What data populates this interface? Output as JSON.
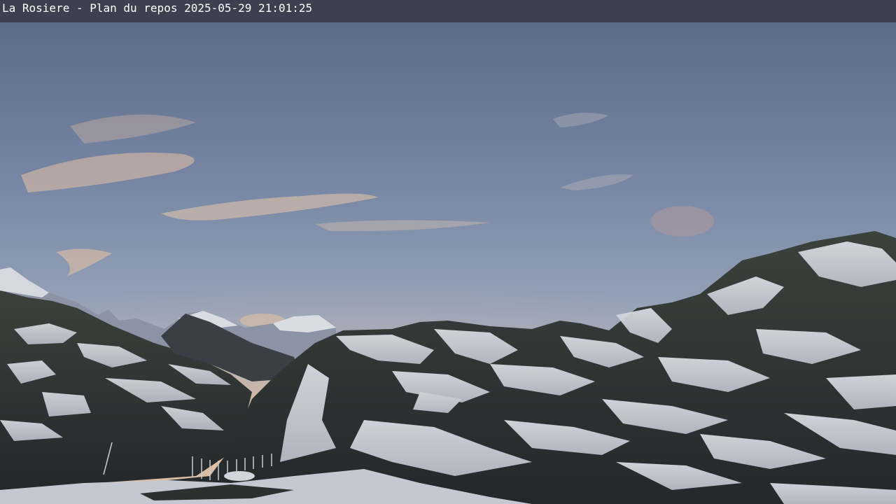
{
  "caption": {
    "location": "La Rosiere - Plan du repos",
    "datetime": "2025-05-29 21:01:25"
  },
  "scene": {
    "description_type": "mountain webcam at dusk",
    "colors": {
      "caption_bar": "#3d414f",
      "sky_top": "#5d6c87",
      "sky_mid": "#8393b0",
      "sky_horizon": "#d7b59c",
      "snow": "#cdd0d8",
      "rock": "#2e3430"
    }
  }
}
